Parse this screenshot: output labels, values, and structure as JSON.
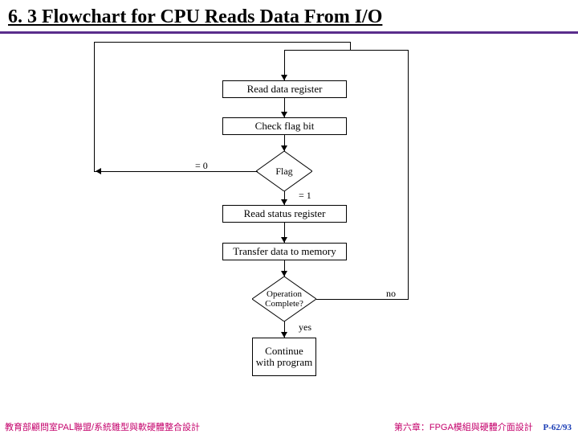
{
  "title": "6. 3 Flowchart for CPU Reads Data From I/O",
  "nodes": {
    "read_data": "Read data register",
    "check_flag": "Check flag bit",
    "flag": "Flag",
    "read_status": "Read status register",
    "transfer": "Transfer data to memory",
    "op_complete": "Operation Complete?",
    "continue": "Continue with program"
  },
  "edges": {
    "flag_zero": "= 0",
    "flag_one": "= 1",
    "yes": "yes",
    "no": "no"
  },
  "footer": {
    "left": "教育部顧問室PAL聯盟/系統雛型與軟硬體整合設計",
    "right": "第六章：FPGA模組與硬體介面設計",
    "page": "P-62/93"
  }
}
